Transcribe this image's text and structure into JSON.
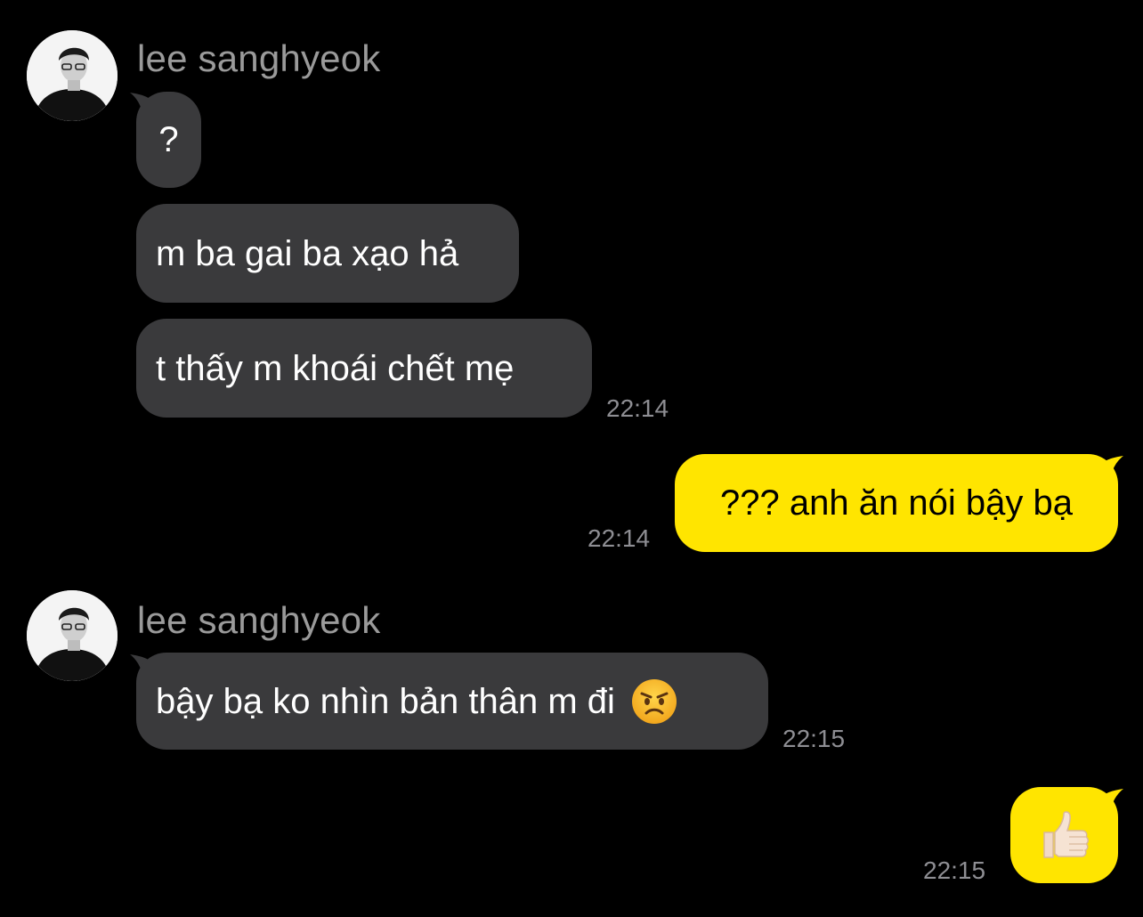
{
  "colors": {
    "background": "#000000",
    "incoming_bubble": "#3a3a3c",
    "outgoing_bubble": "#ffe500",
    "timestamp": "#8e8e93",
    "sender_name": "#9a9a9a"
  },
  "messages": [
    {
      "group": 1,
      "sender": "lee sanghyeok",
      "avatar_icon": "profile-photo-avatar",
      "bubbles": [
        {
          "text": "?"
        },
        {
          "text": "m ba gai ba xạo hả"
        },
        {
          "text": "t thấy m khoái chết mẹ"
        }
      ],
      "time": "22:14"
    },
    {
      "group": 2,
      "outgoing": true,
      "bubbles": [
        {
          "text": "??? anh ăn nói bậy bạ"
        }
      ],
      "time": "22:14"
    },
    {
      "group": 3,
      "sender": "lee sanghyeok",
      "avatar_icon": "profile-photo-avatar",
      "bubbles": [
        {
          "text": "bậy bạ ko nhìn bản thân m đi",
          "emoji_icon": "angry-face-emoji"
        }
      ],
      "time": "22:15"
    },
    {
      "group": 4,
      "outgoing": true,
      "bubbles": [
        {
          "emoji_icon": "thumbs-up-emoji"
        }
      ],
      "time": "22:15"
    }
  ]
}
